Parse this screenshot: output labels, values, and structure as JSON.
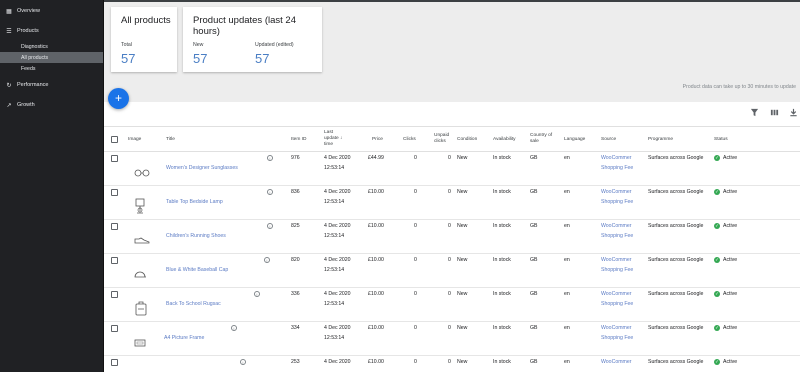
{
  "sidebar": {
    "items": [
      {
        "label": "Overview",
        "icon": "grid-icon"
      },
      {
        "label": "Products",
        "icon": "list-icon"
      },
      {
        "label": "Performance",
        "icon": "refresh-icon"
      },
      {
        "label": "Growth",
        "icon": "trending-up-icon"
      }
    ],
    "products_sub": [
      "Diagnostics",
      "All products",
      "Feeds"
    ],
    "active_sub": "All products"
  },
  "cards": {
    "all_products": {
      "title": "All products",
      "total_label": "Total",
      "total_value": "57"
    },
    "updates": {
      "title": "Product updates (last 24 hours)",
      "new_label": "New",
      "new_value": "57",
      "updated_label": "Updated (edited)",
      "updated_value": "57"
    }
  },
  "fab_label": "+",
  "notice": "Product data can take up to 30 minutes to update",
  "toolbar": {
    "filter_icon": "filter-icon",
    "columns_icon": "columns-icon",
    "download_icon": "download-icon"
  },
  "table": {
    "headers": {
      "image": "Image",
      "title": "Title",
      "item_id": "Item ID",
      "last_update_1": "Last",
      "last_update_2": "update",
      "last_update_3": "time",
      "sort_arrow": "↓",
      "price": "Price",
      "clicks": "Clicks",
      "unpaid_1": "Unpaid",
      "unpaid_2": "clicks",
      "condition": "Condition",
      "availability": "Availability",
      "country_1": "Country of",
      "country_2": "sale",
      "language": "Language",
      "source": "Source",
      "programme": "Programme",
      "status": "Status"
    },
    "rows": [
      {
        "title": "Women's Designer Sunglasses",
        "item_id": "976",
        "date": "4 Dec 2020",
        "time": "12:53:14",
        "price": "£44.99",
        "clicks": "0",
        "unpaid": "0",
        "condition": "New",
        "availability": "In stock",
        "country": "GB",
        "language": "en",
        "source_1": "WooCommer",
        "source_2": "Shopping Fee",
        "programme": "Surfaces across Google",
        "status": "Active",
        "thumb": "sunglasses"
      },
      {
        "title": "Table Top Bedside Lamp",
        "item_id": "836",
        "date": "4 Dec 2020",
        "time": "12:53:14",
        "price": "£10.00",
        "clicks": "0",
        "unpaid": "0",
        "condition": "New",
        "availability": "In stock",
        "country": "GB",
        "language": "en",
        "source_1": "WooCommer",
        "source_2": "Shopping Fee",
        "programme": "Surfaces across Google",
        "status": "Active",
        "thumb": "lamp"
      },
      {
        "title": "Children's Running Shoes",
        "item_id": "825",
        "date": "4 Dec 2020",
        "time": "12:53:14",
        "price": "£10.00",
        "clicks": "0",
        "unpaid": "0",
        "condition": "New",
        "availability": "In stock",
        "country": "GB",
        "language": "en",
        "source_1": "WooCommer",
        "source_2": "Shopping Fee",
        "programme": "Surfaces across Google",
        "status": "Active",
        "thumb": "shoe"
      },
      {
        "title": "Blue & White Baseball Cap",
        "item_id": "820",
        "date": "4 Dec 2020",
        "time": "12:53:14",
        "price": "£10.00",
        "clicks": "0",
        "unpaid": "0",
        "condition": "New",
        "availability": "In stock",
        "country": "GB",
        "language": "en",
        "source_1": "WooCommer",
        "source_2": "Shopping Fee",
        "programme": "Surfaces across Google",
        "status": "Active",
        "thumb": "cap"
      },
      {
        "title": "Back To School Rugsac",
        "item_id": "336",
        "date": "4 Dec 2020",
        "time": "12:53:14",
        "price": "£10.00",
        "clicks": "0",
        "unpaid": "0",
        "condition": "New",
        "availability": "In stock",
        "country": "GB",
        "language": "en",
        "source_1": "WooCommer",
        "source_2": "Shopping Fee",
        "programme": "Surfaces across Google",
        "status": "Active",
        "thumb": "bag"
      },
      {
        "title": "A4 Picture Frame",
        "item_id": "334",
        "date": "4 Dec 2020",
        "time": "12:53:14",
        "price": "£10.00",
        "clicks": "0",
        "unpaid": "0",
        "condition": "New",
        "availability": "In stock",
        "country": "GB",
        "language": "en",
        "source_1": "WooCommer",
        "source_2": "Shopping Fee",
        "programme": "Surfaces across Google",
        "status": "Active",
        "thumb": "frame"
      },
      {
        "title": "",
        "item_id": "253",
        "date": "4 Dec 2020",
        "time": "",
        "price": "£10.00",
        "clicks": "0",
        "unpaid": "0",
        "condition": "New",
        "availability": "In stock",
        "country": "GB",
        "language": "en",
        "source_1": "WooCommer",
        "source_2": "",
        "programme": "Surfaces across Google",
        "status": "Active",
        "thumb": "none"
      }
    ]
  },
  "colors": {
    "sidebar": "#202124",
    "accent": "#1a73e8",
    "link": "#5b7bc4",
    "number": "#4a7ec4",
    "active": "#34a853"
  }
}
